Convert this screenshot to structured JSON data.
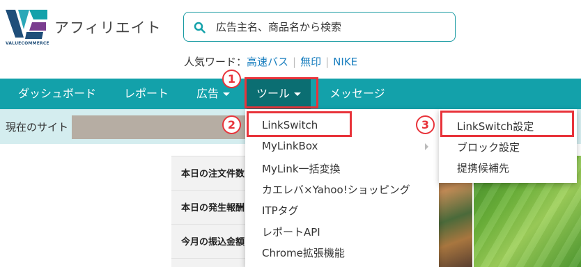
{
  "brand": {
    "logo_text": "VALUECOMMERCE",
    "app_title": "アフィリエイト",
    "colors": {
      "teal": "#13a1aa",
      "teal_dark": "#0b6e72",
      "navy": "#1f4e79",
      "annotation_red": "#e8333a",
      "link_blue": "#1a7fbf"
    }
  },
  "search": {
    "placeholder": "広告主名、商品名から検索",
    "icon": "search-icon"
  },
  "popular_words": {
    "label": "人気ワード：",
    "items": [
      "高速バス",
      "無印",
      "NIKE"
    ]
  },
  "nav": {
    "items": [
      {
        "label": "ダッシュボード"
      },
      {
        "label": "レポート"
      },
      {
        "label": "広告"
      },
      {
        "label": "ツール"
      },
      {
        "label": "メッセージ"
      }
    ],
    "active": "ツール"
  },
  "site_row": {
    "label": "現在のサイト"
  },
  "summary": {
    "rows": [
      "本日の注文件数",
      "本日の発生報酬",
      "今月の振込金額"
    ]
  },
  "tools_menu": {
    "items": [
      {
        "label": "LinkSwitch"
      },
      {
        "label": "MyLinkBox"
      },
      {
        "label": "MyLink一括変換"
      },
      {
        "label": "カエレバ×Yahoo!ショッピング"
      },
      {
        "label": "ITPタグ"
      },
      {
        "label": "レポートAPI"
      },
      {
        "label": "Chrome拡張機能"
      }
    ]
  },
  "linkswitch_submenu": {
    "items": [
      {
        "label": "LinkSwitch設定"
      },
      {
        "label": "ブロック設定"
      },
      {
        "label": "提携候補先"
      }
    ]
  },
  "annotations": {
    "step1": "1",
    "step2": "2",
    "step3": "3"
  }
}
